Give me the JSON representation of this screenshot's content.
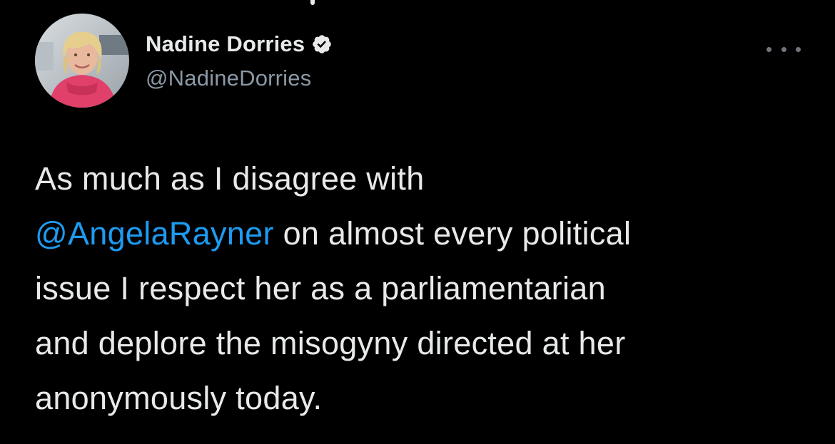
{
  "author": {
    "display_name": "Nadine Dorries",
    "handle": "@NadineDorries",
    "verified": true,
    "avatar_icon": "profile-photo"
  },
  "menu": {
    "more_icon": "more-horizontal-icon"
  },
  "tweet": {
    "line1": "As much as I disagree with",
    "mention": "@AngelaRayner",
    "line2_rest": " on almost every political",
    "line3": "issue I respect her as a parliamentarian",
    "line4": "and deplore the misogyny directed at her",
    "line5": "anonymously today."
  },
  "colors": {
    "background": "#000000",
    "text": "#e7e9ea",
    "secondary_text": "#8b98a5",
    "mention": "#1d9bf0",
    "verified_badge": "#e7e9ea"
  }
}
